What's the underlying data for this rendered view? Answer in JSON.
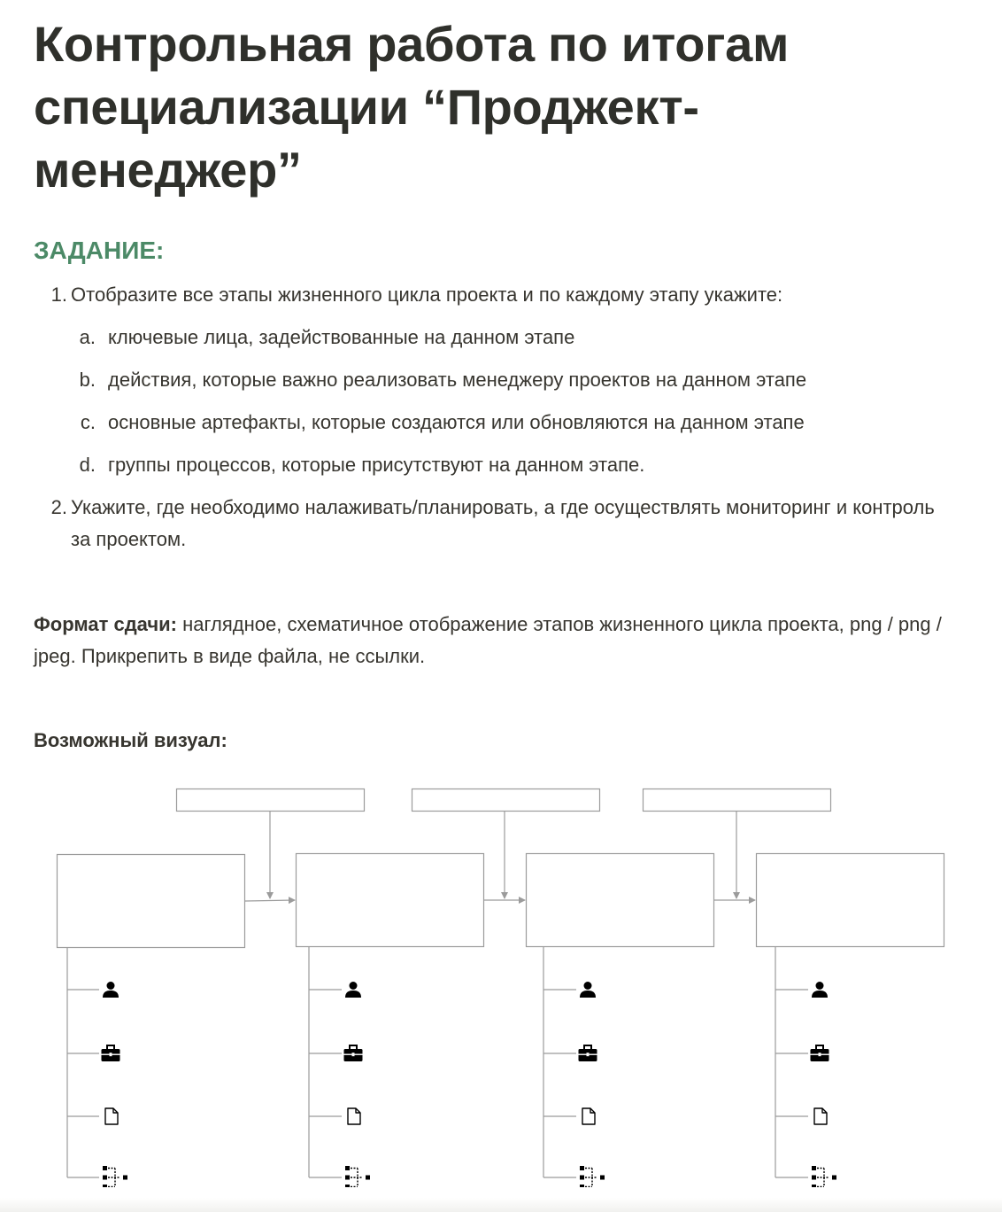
{
  "title": "Контрольная работа по итогам специализации “Проджект-менеджер”",
  "task_heading": "ЗАДАНИЕ:",
  "tasks": [
    {
      "number": "1.",
      "text": "Отобразите все этапы жизненного цикла проекта и по каждому этапу укажите:",
      "subitems": [
        {
          "letter": "a.",
          "text": "ключевые лица, задействованные на данном этапе"
        },
        {
          "letter": "b.",
          "text": "действия, которые важно реализовать менеджеру проектов на данном этапе"
        },
        {
          "letter": "c.",
          "text": "основные артефакты, которые создаются или обновляются на данном этапе"
        },
        {
          "letter": "d.",
          "text": "группы процессов, которые присутствуют на данном этапе."
        }
      ]
    },
    {
      "number": "2.",
      "text": "Укажите, где необходимо налаживать/планировать, а где осуществлять мониторинг и контроль за проектом."
    }
  ],
  "submission": {
    "label": "Формат сдачи:",
    "text": " наглядное, схематичное отображение этапов жизненного цикла проекта, png / png / jpeg. Прикрепить в виде файла, не ссылки."
  },
  "visual_label": "Возможный визуал:",
  "diagram": {
    "stage_count": 4,
    "connector_box_count": 3,
    "branch_icons": [
      "person-icon",
      "briefcase-icon",
      "document-icon",
      "hierarchy-icon"
    ],
    "line_color": "#9b9b9b",
    "icon_color": "#000000"
  }
}
